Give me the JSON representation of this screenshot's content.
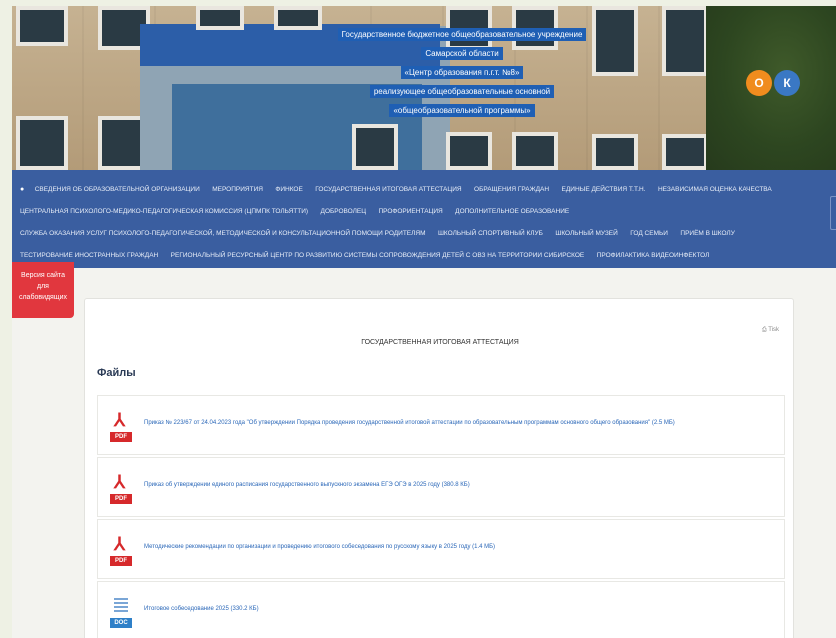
{
  "header": {
    "title_lines": [
      "Государственное бюджетное общеобразовательное учреждение",
      "Самарской области",
      "«Центр образования п.г.т. №8»",
      "реализующее общеобразовательные основной",
      "«общеобразовательной программы»"
    ],
    "social": {
      "ok_glyph": "О",
      "vk_glyph": "К",
      "ok_color": "#f08c1e",
      "vk_color": "#3a78c4"
    }
  },
  "nav": {
    "home_icon": "home-icon",
    "rows": [
      [
        "СВЕДЕНИЯ ОБ ОБРАЗОВАТЕЛЬНОЙ ОРГАНИЗАЦИИ",
        "МЕРОПРИЯТИЯ",
        "ФИНКОЕ",
        "ГОСУДАРСТВЕННАЯ ИТОГОВАЯ АТТЕСТАЦИЯ",
        "ОБРАЩЕНИЯ ГРАЖДАН",
        "ЕДИНЫЕ ДЕЙСТВИЯ Т.Т.Н.",
        "НЕЗАВИСИМАЯ ОЦЕНКА КАЧЕСТВА"
      ],
      [
        "ЦЕНТРАЛЬНАЯ ПСИХОЛОГО-МЕДИКО-ПЕДАГОГИЧЕСКАЯ КОМИССИЯ (ЦПМПК Тольятти)",
        "ДОБРОВОЛЕЦ",
        "ПРОФОРИЕНТАЦИЯ",
        "ДОПОЛНИТЕЛЬНОЕ ОБРАЗОВАНИЕ"
      ],
      [
        "СЛУЖБА ОКАЗАНИЯ УСЛУГ ПСИХОЛОГО-ПЕДАГОГИЧЕСКОЙ, МЕТОДИЧЕСКОЙ И КОНСУЛЬТАЦИОННОЙ ПОМОЩИ РОДИТЕЛЯМ",
        "ШКОЛЬНЫЙ СПОРТИВНЫЙ КЛУБ",
        "ШКОЛЬНЫЙ МУЗЕЙ",
        "ГОД СЕМЬИ",
        "ПРИЁМ В ШКОЛУ"
      ],
      [
        "ТЕСТИРОВАНИЕ ИНОСТРАННЫХ ГРАЖДАН",
        "РЕГИОНАЛЬНЫЙ РЕСУРСНЫЙ ЦЕНТР ПО РАЗВИТИЮ СИСТЕМЫ СОПРОВОЖДЕНИЯ ДЕТЕЙ С ОВЗ НА ТЕРРИТОРИИ СИБИРСКОЕ",
        "ПРОФИЛАКТИКА ВИДЕОИНФЕКТОЛ"
      ]
    ]
  },
  "accessibility": {
    "line1": "Версия сайта",
    "line2": "для",
    "line3": "слабовидящих"
  },
  "main": {
    "print_label": "⎙ Tisk",
    "page_title": "ГОСУДАРСТВЕННАЯ ИТОГОВАЯ АТТЕСТАЦИЯ",
    "files_heading": "Файлы",
    "files": [
      {
        "type": "PDF",
        "label": "Приказ № 223/67 от 24.04.2023 года \"Об утверждении Порядка проведения государственной итоговой аттестации по образовательным программам основного общего образования\" (2.5 МБ)"
      },
      {
        "type": "PDF",
        "label": "Приказ об утверждении единого расписания государственного выпускного экзамена ЕГЭ ОГЭ в 2025 году (380.8 КБ)"
      },
      {
        "type": "PDF",
        "label": "Методические рекомендации по организации и проведению итогового собеседования по русскому языку в 2025 году (1.4 МБ)"
      },
      {
        "type": "DOC",
        "label": "Итоговое собеседование 2025 (330.2 КБ)"
      }
    ]
  },
  "colors": {
    "nav_bg": "#3a5ea0",
    "access_bg": "#e1373e",
    "link": "#2a67b8"
  }
}
